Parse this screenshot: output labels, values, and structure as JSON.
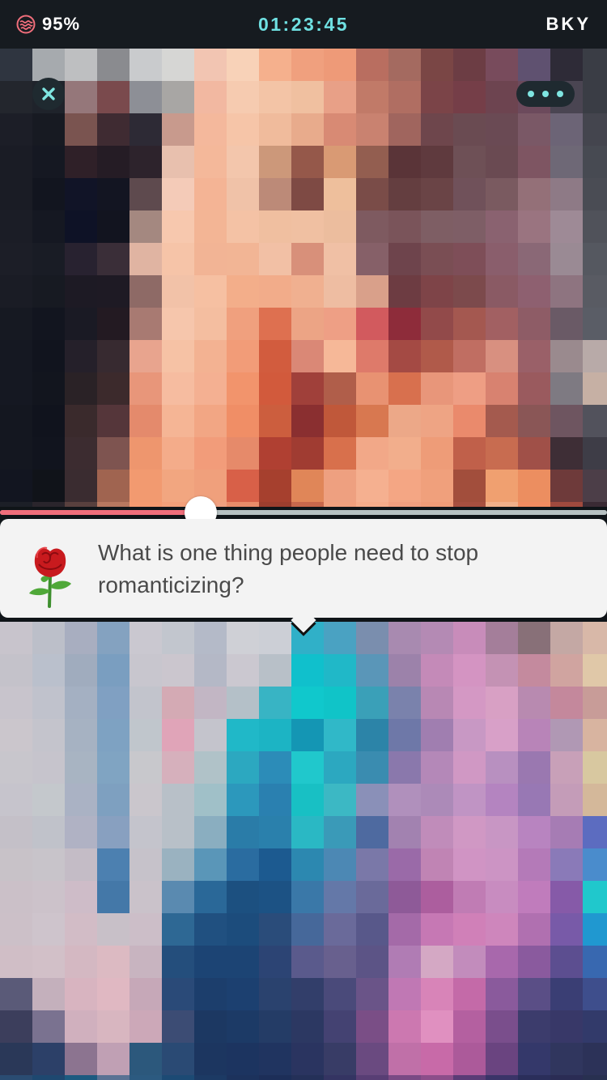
{
  "status_bar": {
    "battery": "95%",
    "timer": "01:23:45",
    "partner_code": "BKY",
    "battery_icon": "wave-logo-icon"
  },
  "call": {
    "close_icon": "close-icon",
    "more_icon": "more-options-icon",
    "progress_percent": 33
  },
  "prompt": {
    "icon": "rose-icon",
    "text": "What is one thing people need to stop romanticizing?"
  },
  "colors": {
    "accent_teal": "#6fe0e2",
    "progress_pink": "#f06e7b",
    "card_bg": "#f3f3f3"
  }
}
